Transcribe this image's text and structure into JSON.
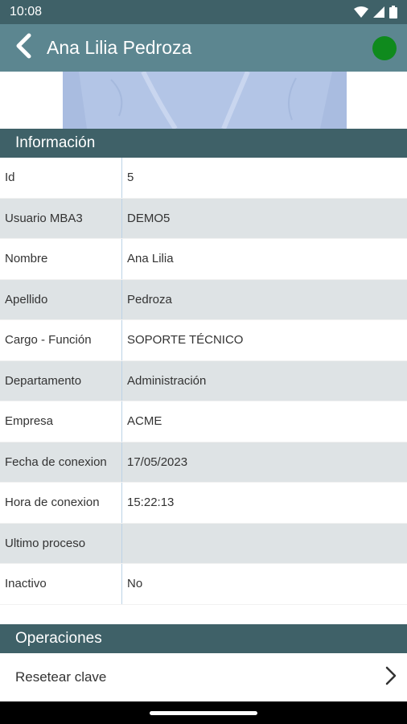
{
  "status_bar": {
    "time": "10:08",
    "icons": [
      "wifi-icon",
      "signal-icon",
      "battery-icon"
    ]
  },
  "app_bar": {
    "title": "Ana Lilia Pedroza",
    "back_icon": "chevron-left-icon",
    "status_color": "#0f8a1d"
  },
  "sections": {
    "info_title": "Información",
    "operations_title": "Operaciones"
  },
  "info_rows": [
    {
      "label": "Id",
      "value": "5"
    },
    {
      "label": "Usuario MBA3",
      "value": "DEMO5"
    },
    {
      "label": "Nombre",
      "value": "Ana Lilia"
    },
    {
      "label": "Apellido",
      "value": "Pedroza"
    },
    {
      "label": "Cargo - Función",
      "value": "SOPORTE TÉCNICO"
    },
    {
      "label": "Departamento",
      "value": "Administración"
    },
    {
      "label": "Empresa",
      "value": "ACME"
    },
    {
      "label": "Fecha de conexion",
      "value": "17/05/2023"
    },
    {
      "label": "Hora de conexion",
      "value": "15:22:13"
    },
    {
      "label": "Ultimo proceso",
      "value": ""
    },
    {
      "label": "Inactivo",
      "value": "No"
    }
  ],
  "operations": [
    {
      "label": "Resetear clave",
      "icon": "chevron-right-icon"
    }
  ],
  "colors": {
    "status_bar": "#3f6168",
    "app_bar": "#5c8690",
    "section_header": "#3f6168",
    "row_alt": "#dee3e5"
  }
}
